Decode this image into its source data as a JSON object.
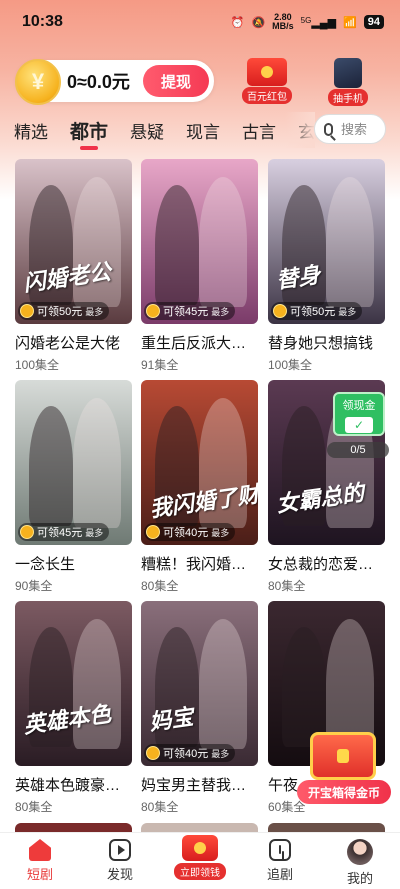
{
  "status_bar": {
    "time": "10:38",
    "net_speed_value": "2.80",
    "net_speed_unit": "MB/s",
    "network": "5G",
    "battery": "94"
  },
  "wallet": {
    "coin_symbol": "¥",
    "amount": "0≈0.0元",
    "withdraw_label": "提现"
  },
  "promos": [
    {
      "label": "百元红包",
      "icon": "red-envelope-icon"
    },
    {
      "label": "抽手机",
      "icon": "phone-icon"
    }
  ],
  "tabs": [
    {
      "label": "精选",
      "active": false
    },
    {
      "label": "都市",
      "active": true
    },
    {
      "label": "悬疑",
      "active": false
    },
    {
      "label": "现言",
      "active": false
    },
    {
      "label": "古言",
      "active": false
    },
    {
      "label": "玄",
      "active": false
    }
  ],
  "search": {
    "placeholder": "搜索"
  },
  "dramas": [
    {
      "title": "闪婚老公是大佬",
      "episodes": "100集全",
      "reward": "可领50元",
      "reward_suffix": "最多",
      "poster_text": "闪婚老公",
      "colors": [
        "#d9c2c9",
        "#5a3b3f"
      ]
    },
    {
      "title": "重生后反派大…",
      "episodes": "91集全",
      "reward": "可领45元",
      "reward_suffix": "最多",
      "poster_text": "",
      "colors": [
        "#e8a7c8",
        "#7a3b69"
      ]
    },
    {
      "title": "替身她只想搞钱",
      "episodes": "100集全",
      "reward": "可领50元",
      "reward_suffix": "最多",
      "poster_text": "替身",
      "colors": [
        "#d8cfe0",
        "#3b3344"
      ]
    },
    {
      "title": "一念长生",
      "episodes": "90集全",
      "reward": "可领45元",
      "reward_suffix": "最多",
      "poster_text": "",
      "colors": [
        "#d7dbd8",
        "#6f7a74"
      ]
    },
    {
      "title": "糟糕！我闪婚…",
      "episodes": "80集全",
      "reward": "可领40元",
      "reward_suffix": "最多",
      "poster_text": "我闪婚了财阀叔",
      "colors": [
        "#b84a34",
        "#4a1e18"
      ]
    },
    {
      "title": "女总裁的恋爱…",
      "episodes": "80集全",
      "reward": "",
      "reward_suffix": "",
      "poster_text": "女霸总的",
      "colors": [
        "#5b3a52",
        "#1e1420"
      ]
    },
    {
      "title": "英雄本色踱豪…",
      "episodes": "80集全",
      "reward": "",
      "reward_suffix": "",
      "poster_text": "英雄本色",
      "colors": [
        "#7c5a62",
        "#2a1c24"
      ]
    },
    {
      "title": "妈宝男主替我…",
      "episodes": "80集全",
      "reward": "可领40元",
      "reward_suffix": "最多",
      "poster_text": "妈宝",
      "colors": [
        "#8a6f7b",
        "#3a2a33"
      ]
    },
    {
      "title": "午夜…",
      "episodes": "60集全",
      "reward": "",
      "reward_suffix": "",
      "poster_text": "",
      "colors": [
        "#3b2830",
        "#140c10"
      ]
    }
  ],
  "cash_widget": {
    "title": "领现金",
    "progress": "0/5"
  },
  "chest": {
    "label": "开宝箱得金币"
  },
  "bottom_nav": [
    {
      "label": "短剧",
      "icon": "home-icon",
      "active": true
    },
    {
      "label": "发现",
      "icon": "play-icon",
      "active": false
    },
    {
      "label": "立即领钱",
      "icon": "red-envelope-icon",
      "active": false
    },
    {
      "label": "追剧",
      "icon": "bookmark-icon",
      "active": false
    },
    {
      "label": "我的",
      "icon": "avatar-icon",
      "active": false
    }
  ]
}
